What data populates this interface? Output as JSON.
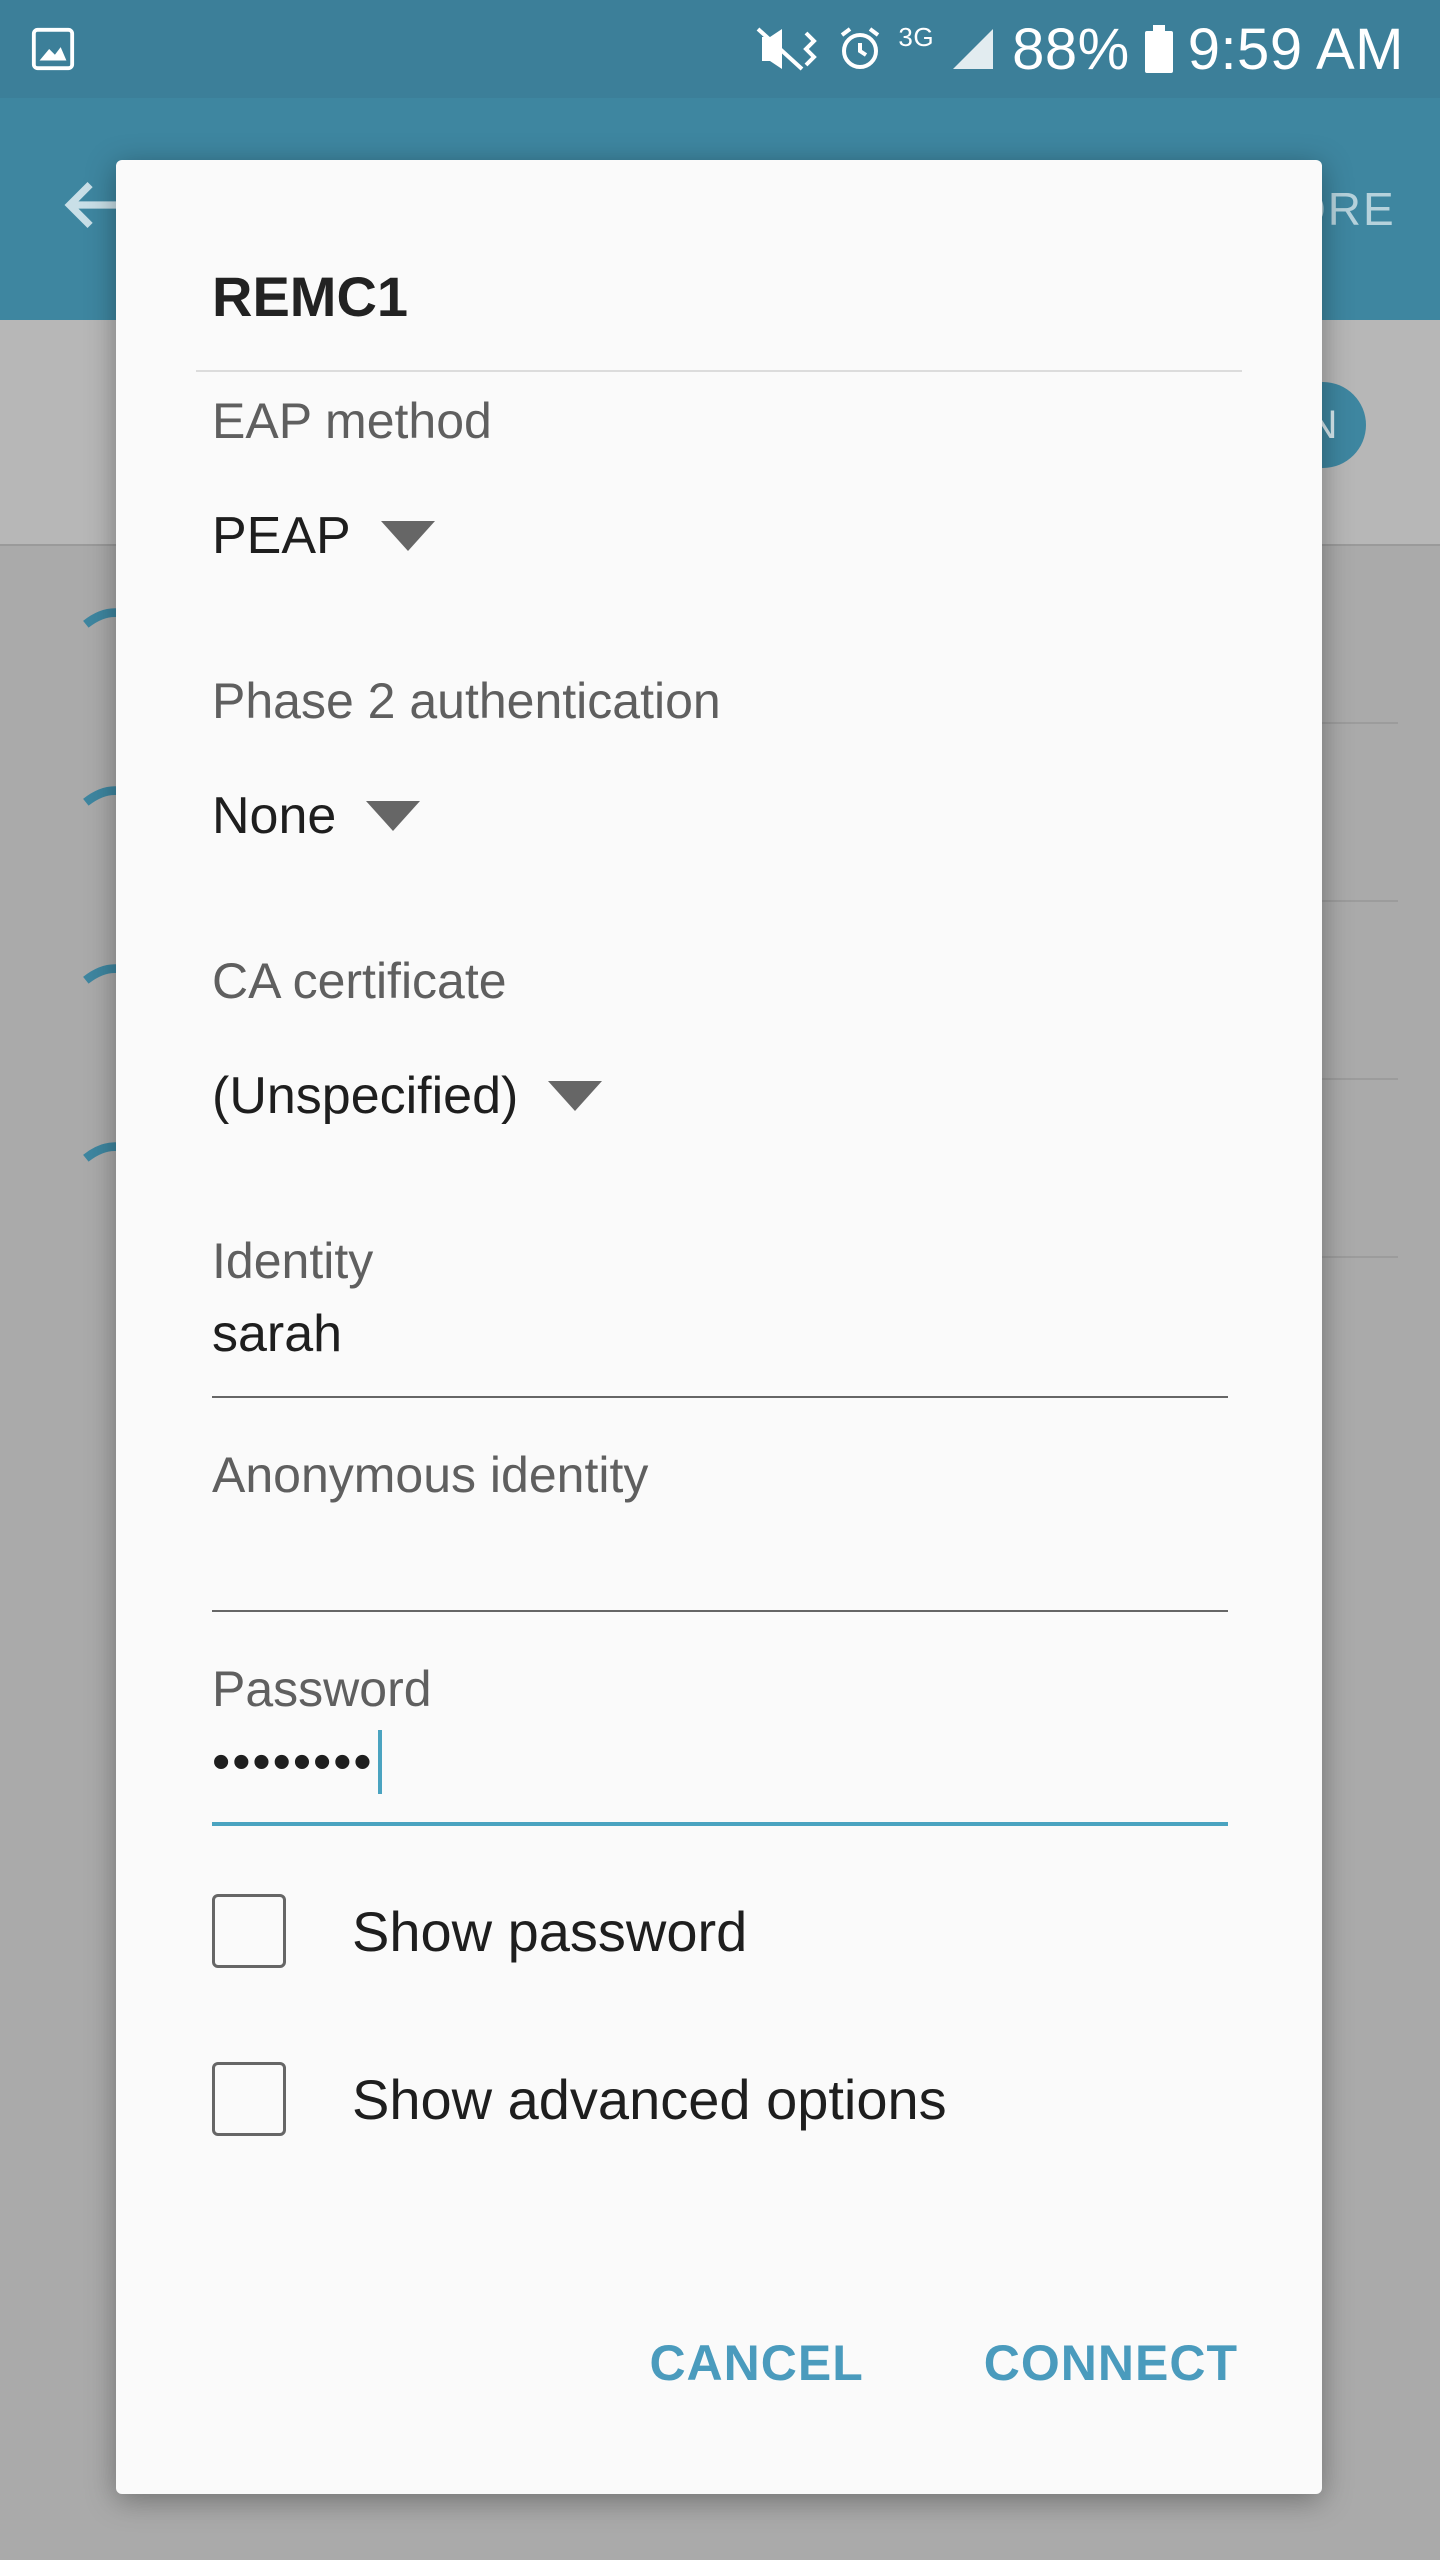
{
  "status_bar": {
    "battery": "88%",
    "time": "9:59 AM",
    "network": "3G",
    "icons": [
      "gallery-icon",
      "mute-vibrate-icon",
      "alarm-icon",
      "network-3g-icon",
      "signal-icon",
      "battery-icon"
    ]
  },
  "app_bar": {
    "back_icon": "arrow-back-icon",
    "more_label": "ORE"
  },
  "toggle": {
    "label": "N"
  },
  "dialog": {
    "title": "REMC1",
    "eap_method": {
      "label": "EAP method",
      "value": "PEAP"
    },
    "phase2": {
      "label": "Phase 2 authentication",
      "value": "None"
    },
    "ca_certificate": {
      "label": "CA certificate",
      "value": "(Unspecified)"
    },
    "identity": {
      "label": "Identity",
      "value": "sarah"
    },
    "anonymous_identity": {
      "label": "Anonymous identity",
      "value": ""
    },
    "password": {
      "label": "Password",
      "value": "••••••••"
    },
    "show_password": {
      "label": "Show password",
      "checked": false
    },
    "show_advanced": {
      "label": "Show advanced options",
      "checked": false
    },
    "cancel_label": "CANCEL",
    "connect_label": "CONNECT"
  },
  "colors": {
    "accent": "#4a9bbd",
    "status_bar": "#3c7f99",
    "app_bar": "#3e86a0"
  }
}
